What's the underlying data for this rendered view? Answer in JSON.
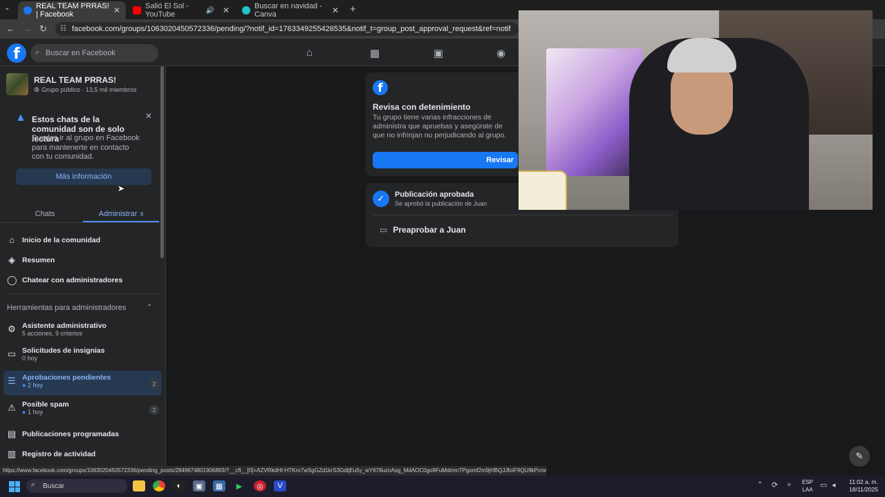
{
  "browser": {
    "tabs": [
      {
        "title": "REAL TEAM PRRAS! | Facebook",
        "color": "#1877f2",
        "active": true
      },
      {
        "title": "Salió El Sol - YouTube",
        "color": "#ff0000",
        "active": false
      },
      {
        "title": "Buscar en navidad - Canva",
        "color": "#20c4cb",
        "active": false
      }
    ],
    "url": "facebook.com/groups/1063020450572336/pending/?notif_id=1763349255426535&notif_t=group_post_approval_request&ref=notif",
    "status_url": "https://www.facebook.com/groups/1063020450572336/pending_posts/2849674801906883/?__cft__[0]=AZVRkdHf-HTKro7wSgGZd1krS3GdljEu5y_wY678uznAsg_MdAOC0go9FuMdmmTPgomf2m9jHBQJJfoiF9QU9kPcnwSjL..."
  },
  "facebook": {
    "search_placeholder": "Buscar en Facebook"
  },
  "group": {
    "name": "REAL TEAM PRRAS!",
    "meta": "Grupo público · 13,5 mil miembros"
  },
  "notice": {
    "title": "Estos chats de la comunidad son de solo lectura",
    "body": "Puedes ir al grupo en Facebook para mantenerte en contacto con tu comunidad.",
    "button": "Más información"
  },
  "side_tabs": {
    "chats": "Chats",
    "admin": "Administrar",
    "admin_count": "9"
  },
  "nav": [
    {
      "label": "Inicio de la comunidad",
      "icon": "home-icon"
    },
    {
      "label": "Resumen",
      "icon": "layers-icon"
    },
    {
      "label": "Chatear con administradores",
      "icon": "chat-icon"
    }
  ],
  "admin_tools": {
    "heading": "Herramientas para administradores",
    "items": [
      {
        "label": "Asistente administrativo",
        "sub": "5 acciones, 9 criterios",
        "badge": "",
        "icon": "gear-icon"
      },
      {
        "label": "Solicitudes de insignias",
        "sub": "0 hoy",
        "badge": "",
        "icon": "badge-icon"
      },
      {
        "label": "Aprobaciones pendientes",
        "sub": "2 hoy",
        "badge": "2",
        "icon": "approvals-icon"
      },
      {
        "label": "Posible spam",
        "sub": "1 hoy",
        "badge": "2",
        "icon": "warning-icon"
      },
      {
        "label": "Publicaciones programadas",
        "sub": "",
        "badge": "",
        "icon": "calendar-icon"
      },
      {
        "label": "Registro de actividad",
        "sub": "",
        "badge": "",
        "icon": "log-icon"
      }
    ]
  },
  "review_card": {
    "title": "Revisa con detenimiento",
    "body": "Tu grupo tiene varias infracciones de administra que apruebas y asegúrate de que no infrinjan nu perjudicando al grupo.",
    "button": "Revisar"
  },
  "approved_card": {
    "title": "Publicación aprobada",
    "sub": "Se aprobó la publicación de Juan",
    "action": "Preaprobar a Juan"
  },
  "taskbar": {
    "search": "Buscar",
    "lang": "ESP",
    "layout": "LAA",
    "time": "11:02 a. m.",
    "date": "18/11/2025"
  }
}
